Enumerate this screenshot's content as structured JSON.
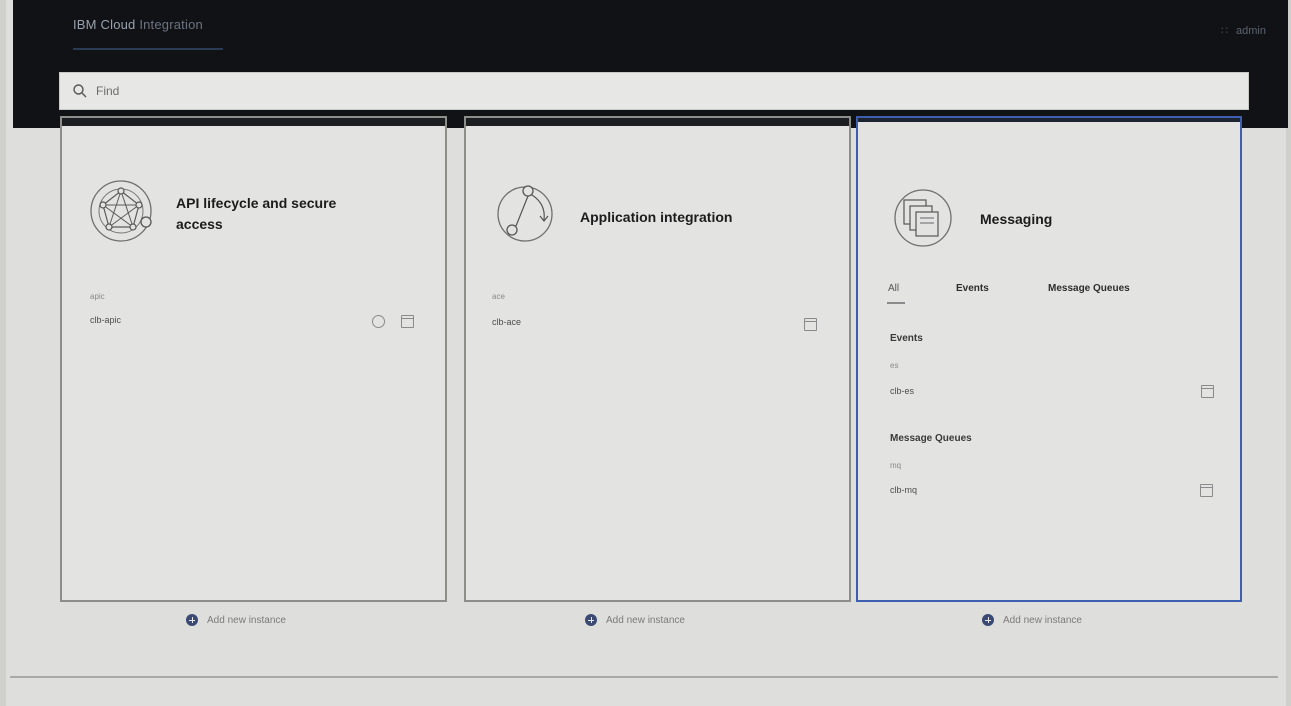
{
  "header": {
    "brand": "IBM Cloud",
    "product": "Integration",
    "user": "admin"
  },
  "search": {
    "placeholder": "Find",
    "value": ""
  },
  "tiles": [
    {
      "title": "API lifecycle and secure access",
      "icon": "api-network-icon",
      "instance_type": "apic",
      "instance_name": "clb-apic",
      "add_label": "Add new instance"
    },
    {
      "title": "Application integration",
      "icon": "app-integration-icon",
      "instance_type": "ace",
      "instance_name": "clb-ace",
      "add_label": "Add new instance"
    },
    {
      "title": "Messaging",
      "icon": "messaging-icon",
      "tabs": [
        "All",
        "Events",
        "Message Queues"
      ],
      "active_tab": "All",
      "sections": [
        {
          "heading": "Events",
          "instance_type": "es",
          "instance_name": "clb-es"
        },
        {
          "heading": "Message Queues",
          "instance_type": "mq",
          "instance_name": "clb-mq"
        }
      ],
      "add_label": "Add new instance"
    }
  ],
  "colors": {
    "header_bg": "#101216",
    "accent": "#3e5fb0",
    "tile_bg": "#e3e3e1"
  }
}
